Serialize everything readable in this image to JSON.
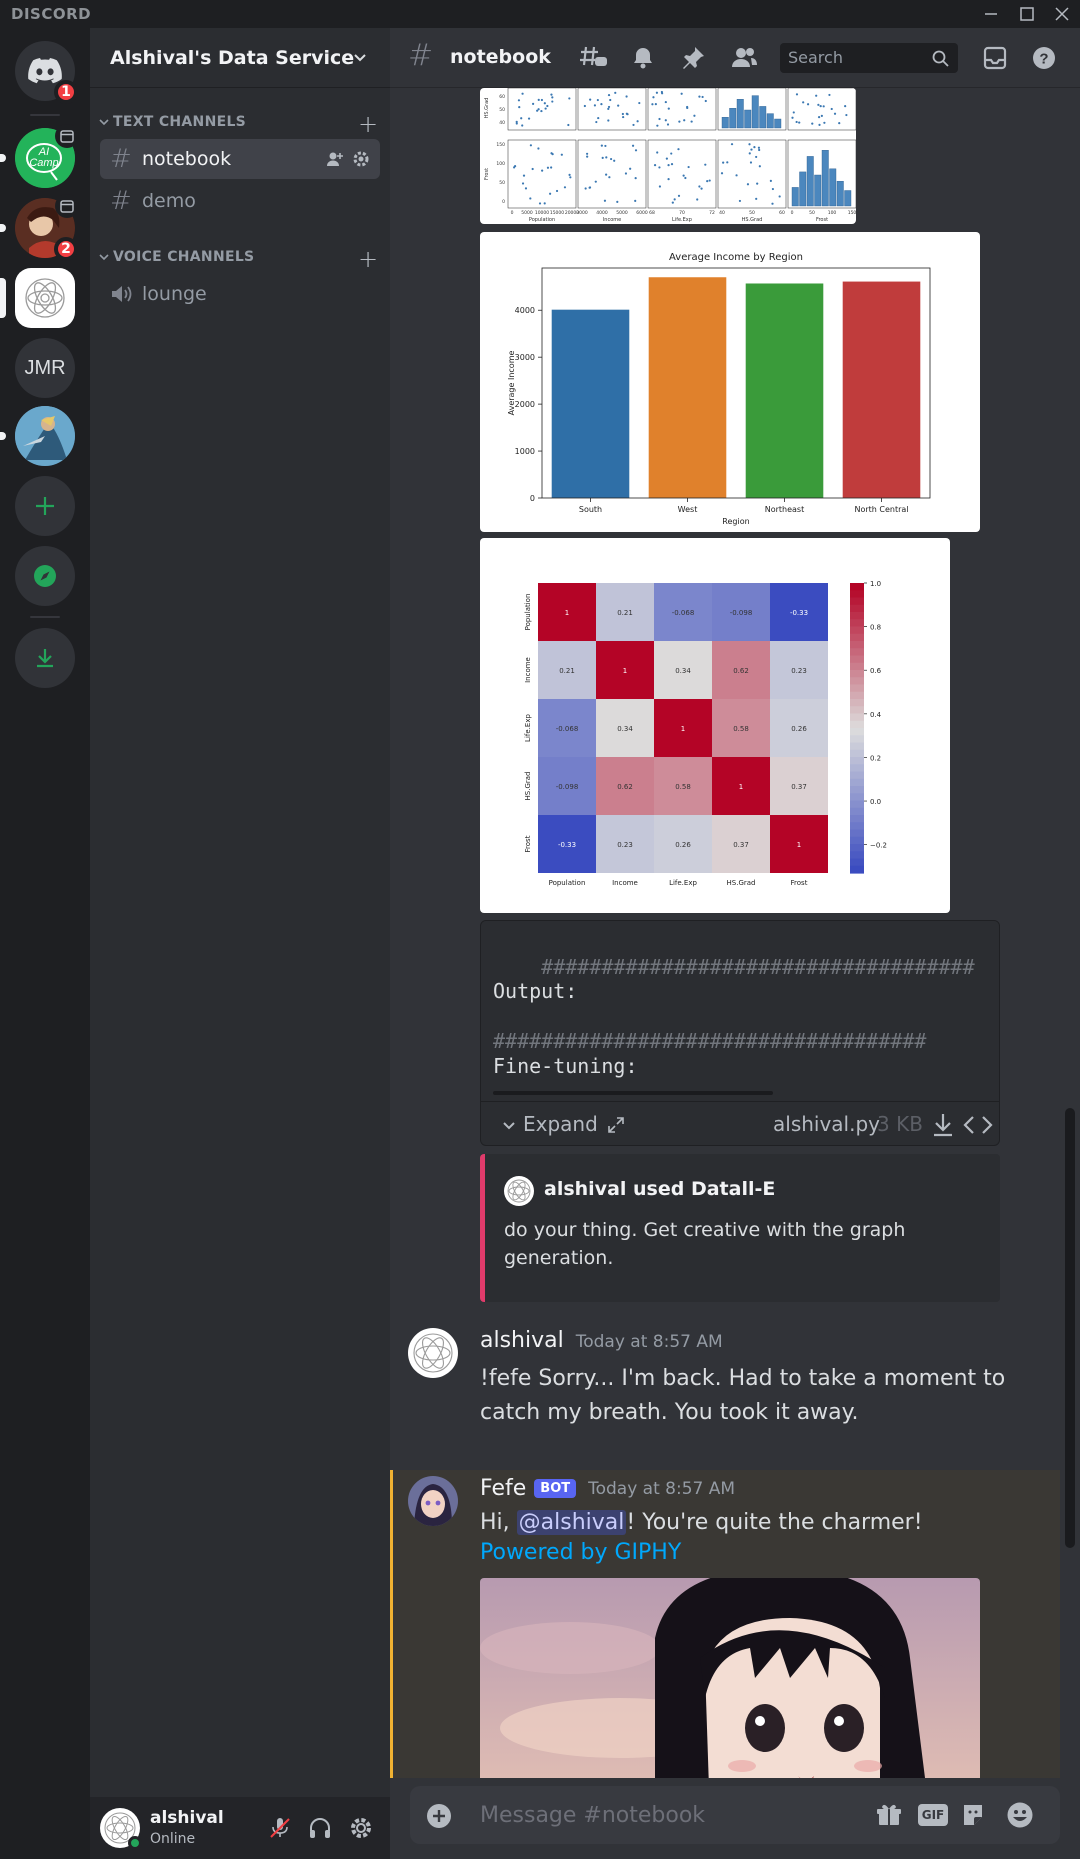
{
  "window": {
    "brand": "DISCORD"
  },
  "servers": {
    "home_badge": "1",
    "aicamp_label": "AI Camp",
    "server3_badge": "2",
    "jmr_label": "JMR"
  },
  "sidebar": {
    "guild_name": "Alshival's Data Service",
    "text_category": "TEXT CHANNELS",
    "voice_category": "VOICE CHANNELS",
    "channels": [
      {
        "name": "notebook"
      },
      {
        "name": "demo"
      }
    ],
    "voice_channels": [
      {
        "name": "lounge"
      }
    ]
  },
  "user": {
    "name": "alshival",
    "status": "Online"
  },
  "topbar": {
    "channel": "notebook",
    "search_placeholder": "Search"
  },
  "charts": {
    "pairplot": {
      "xlabels": [
        "Population",
        "Income",
        "Life.Exp",
        "HS.Grad",
        "Frost"
      ],
      "row_labels": [
        "HS.Grad",
        "Frost"
      ],
      "xticks": [
        [
          "0",
          "5000",
          "10000",
          "15000",
          "20000"
        ],
        [
          "3000",
          "4000",
          "5000",
          "6000"
        ],
        [
          "68",
          "70",
          "72"
        ],
        [
          "40",
          "50",
          "60"
        ],
        [
          "0",
          "50",
          "100",
          "150"
        ]
      ],
      "yticks_top": [
        "60",
        "50",
        "40"
      ],
      "yticks_bottom": [
        "150",
        "100",
        "50",
        "0"
      ]
    },
    "heatmap_rows": [
      "Population",
      "Income",
      "Life.Exp",
      "HS.Grad",
      "Frost"
    ],
    "heatmap_cols": [
      "Population",
      "Income",
      "Life.Exp",
      "HS.Grad",
      "Frost"
    ],
    "colorbar_ticks": [
      "1.0",
      "0.8",
      "0.6",
      "0.4",
      "0.2",
      "0.0",
      "−0.2"
    ]
  },
  "chart_data": [
    {
      "type": "bar",
      "title": "Average Income by Region",
      "xlabel": "Region",
      "ylabel": "Average Income",
      "categories": [
        "South",
        "West",
        "Northeast",
        "North Central"
      ],
      "values": [
        4012,
        4703,
        4570,
        4611
      ],
      "colors": [
        "#2f6fa7",
        "#e0812c",
        "#3a9b3a",
        "#c03c3c"
      ],
      "ylim": [
        0,
        4900
      ],
      "yticks": [
        "0",
        "1000",
        "2000",
        "3000",
        "4000"
      ]
    },
    {
      "type": "heatmap",
      "rows": [
        "Population",
        "Income",
        "Life.Exp",
        "HS.Grad",
        "Frost"
      ],
      "cols": [
        "Population",
        "Income",
        "Life.Exp",
        "HS.Grad",
        "Frost"
      ],
      "values": [
        [
          1,
          0.21,
          -0.068,
          -0.098,
          -0.33
        ],
        [
          0.21,
          1,
          0.34,
          0.62,
          0.23
        ],
        [
          -0.068,
          0.34,
          1,
          0.58,
          0.26
        ],
        [
          -0.098,
          0.62,
          0.58,
          1,
          0.37
        ],
        [
          -0.33,
          0.23,
          0.26,
          0.37,
          1
        ]
      ],
      "labels": [
        [
          "1",
          "0.21",
          "-0.068",
          "-0.098",
          "-0.33"
        ],
        [
          "0.21",
          "1",
          "0.34",
          "0.62",
          "0.23"
        ],
        [
          "-0.068",
          "0.34",
          "1",
          "0.58",
          "0.26"
        ],
        [
          "-0.098",
          "0.62",
          "0.58",
          "1",
          "0.37"
        ],
        [
          "-0.33",
          "0.23",
          "0.26",
          "0.37",
          "1"
        ]
      ],
      "colorbar": [
        "1.0",
        "0.8",
        "0.6",
        "0.4",
        "0.2",
        "0.0",
        "−0.2"
      ]
    }
  ],
  "attachment": {
    "line1": "    ####################################",
    "line2": "Output:",
    "line3": "####################################",
    "line4": "Fine-tuning:",
    "expand_label": "Expand",
    "filename": "alshival.py",
    "size": "3 KB"
  },
  "embed": {
    "author": "alshival used Datall-E",
    "text": "do your thing. Get creative with the graph generation.",
    "accent": "#e03b6b"
  },
  "messages": [
    {
      "author": "alshival",
      "time": "Today at 8:57 AM",
      "text": "!fefe Sorry... I'm back. Had to take a moment to catch my breath. You took it away."
    },
    {
      "author": "Fefe",
      "bot_tag": "BOT",
      "time": "Today at 8:57 AM",
      "text_before": "Hi, ",
      "mention": "@alshival",
      "text_after": "! You're quite the charmer!",
      "link": "Powered by GIPHY",
      "accent": "#f0b232"
    }
  ],
  "composer": {
    "placeholder": "Message #notebook",
    "gif_label": "GIF"
  }
}
